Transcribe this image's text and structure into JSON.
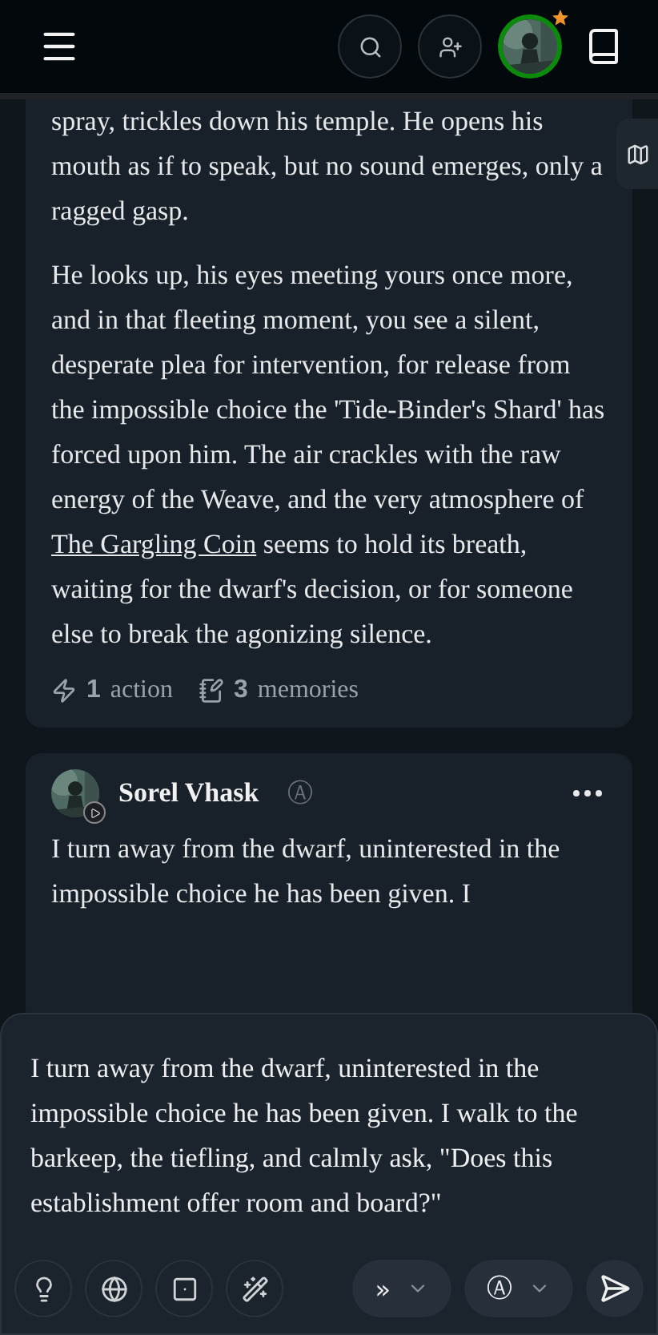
{
  "header": {
    "notification": true
  },
  "messages": [
    {
      "kind": "narration",
      "paragraphs": [
        [
          {
            "text": "spray, trickles down his temple. He opens his mouth as if to speak, but no sound emerges, only a ragged gasp.",
            "kind": "text"
          }
        ],
        [
          {
            "text": "He looks up, his eyes meeting yours once more, and in that fleeting moment, you see a silent, desperate plea for intervention, for release from the impossible choice the 'Tide-Binder's Shard' has forced upon him. The air crackles with the raw energy of the Weave, and the very atmosphere of ",
            "kind": "text"
          },
          {
            "text": "The Gargling Coin",
            "kind": "link"
          },
          {
            "text": " seems to hold its breath, waiting for the dwarf's decision, or for someone else to break the agonizing silence.",
            "kind": "text"
          }
        ]
      ],
      "stats": [
        {
          "kind": "action",
          "count": "1",
          "label": "action"
        },
        {
          "kind": "memories",
          "count": "3",
          "label": "memories"
        }
      ]
    },
    {
      "kind": "player",
      "author": "Sorel Vhask",
      "badge": "Ⓐ",
      "paragraphs": [
        [
          {
            "text": "I turn away from the dwarf, uninterested in the impossible choice he has been given. I",
            "kind": "text"
          }
        ]
      ]
    }
  ],
  "composer": {
    "value": "I turn away from the dwarf, uninterested in the impossible choice he has been given. I walk to the barkeep, the tiefling, and calmly ask, \"Does this establishment offer room and board?\"",
    "tools": [
      {
        "kind": "idea"
      },
      {
        "kind": "web"
      },
      {
        "kind": "dice"
      },
      {
        "kind": "magic"
      }
    ],
    "mode_selector": "»",
    "model_selector": "Ⓐ"
  }
}
